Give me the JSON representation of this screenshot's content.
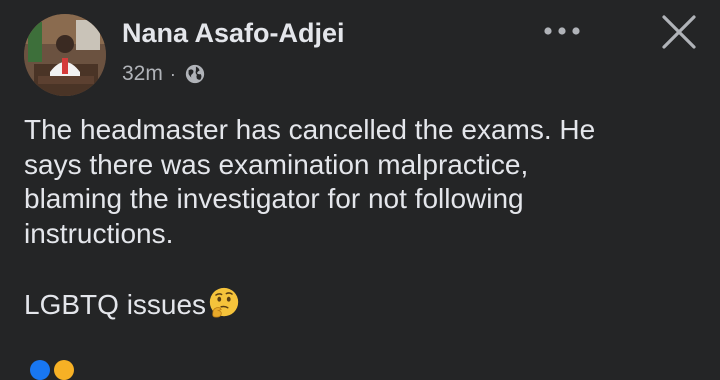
{
  "author": {
    "name": "Nana Asafo-Adjei",
    "avatar_icon": "profile-photo"
  },
  "meta": {
    "time": "32m",
    "separator": "·",
    "audience_icon": "globe-icon"
  },
  "header_actions": {
    "more_icon": "more-options-icon",
    "close_icon": "close-icon"
  },
  "post": {
    "line1": "The headmaster has cancelled the exams. He",
    "line2": "says there was examination malpractice,",
    "line3": "blaming the investigator for not following",
    "line4": "instructions.",
    "line5": "LGBTQ issues",
    "emoji_icon": "thinking-face-emoji"
  },
  "colors": {
    "background": "#242526",
    "primary_text": "#e4e6eb",
    "secondary_text": "#b0b3b8",
    "reaction_blue": "#1877f2",
    "reaction_yellow": "#f7b125"
  }
}
